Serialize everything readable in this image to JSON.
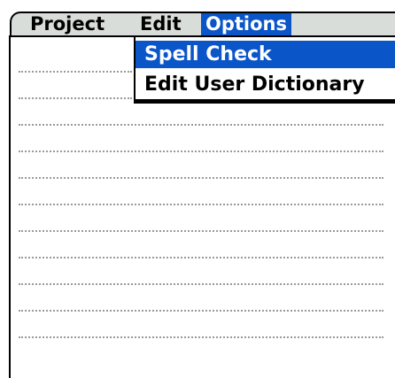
{
  "menubar": {
    "items": [
      {
        "label": "Project",
        "active": false
      },
      {
        "label": "Edit",
        "active": false
      },
      {
        "label": "Options",
        "active": true
      }
    ]
  },
  "options_menu": {
    "items": [
      {
        "label": "Spell Check",
        "selected": true
      },
      {
        "label": "Edit User Dictionary",
        "selected": false
      }
    ]
  },
  "note": {
    "line_count": 11
  },
  "colors": {
    "highlight": "#0a55c8",
    "menubar_bg": "#d9ddd9",
    "dotted_line": "#9a9a9a"
  }
}
